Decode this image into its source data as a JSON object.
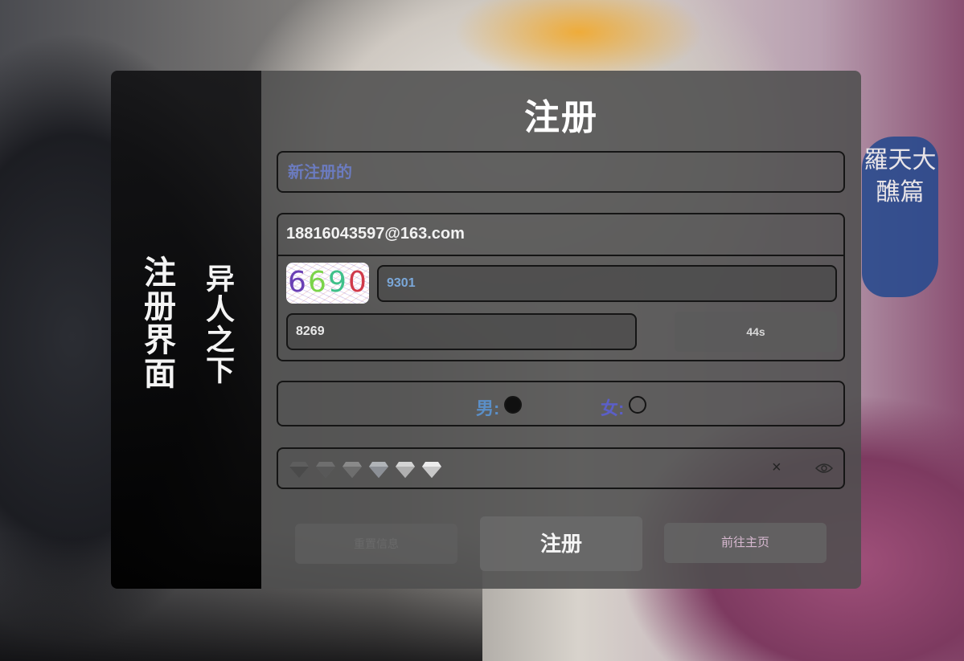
{
  "page": {
    "title": "注册"
  },
  "side": {
    "title_left": "注册界面",
    "title_right": "异人之下"
  },
  "form": {
    "name_placeholder": "新注册的",
    "email": "18816043597@163.com",
    "captcha_chars": [
      "6",
      "6",
      "9",
      "0"
    ],
    "captcha_value": "9301",
    "email_code_value": "8269",
    "countdown_label": "44s",
    "gender": {
      "male_label": "男:",
      "female_label": "女:",
      "selected": "male"
    },
    "password_strength_icons": [
      "diamond-icon",
      "diamond-icon",
      "diamond-icon",
      "diamond-icon",
      "diamond-icon",
      "diamond-icon"
    ]
  },
  "buttons": {
    "reset_label": "重置信息",
    "register_label": "注册",
    "home_label": "前往主页"
  },
  "background": {
    "seal_text": "羅天大醮篇"
  },
  "colors": {
    "accent_blue": "#5b8fc7",
    "accent_purple": "#5b5fc7",
    "name_placeholder": "#6b7bbf"
  }
}
